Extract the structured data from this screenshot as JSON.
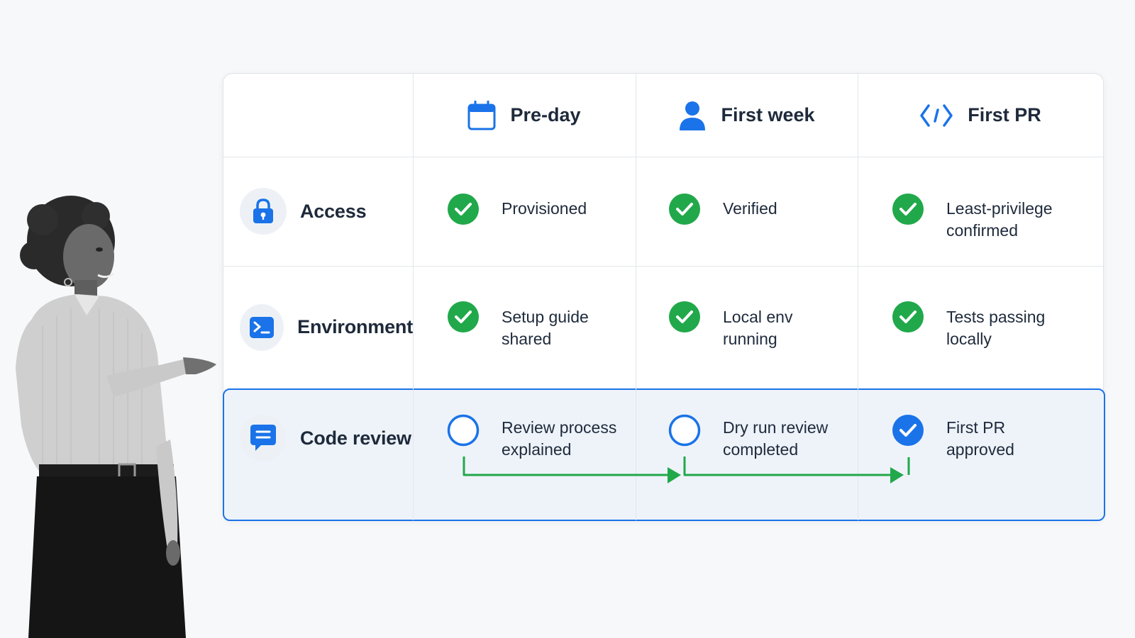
{
  "columns": [
    {
      "label": "Pre-day",
      "icon": "calendar-icon"
    },
    {
      "label": "First week",
      "icon": "user-icon"
    },
    {
      "label": "First PR",
      "icon": "code-icon"
    }
  ],
  "rows": [
    {
      "label": "Access",
      "icon": "lock-icon",
      "cells": [
        {
          "text": "Provisioned",
          "status": "done"
        },
        {
          "text": "Verified",
          "status": "done"
        },
        {
          "text": "Least-privilege confirmed",
          "status": "done"
        }
      ]
    },
    {
      "label": "Environment",
      "icon": "terminal-icon",
      "cells": [
        {
          "text": "Setup guide shared",
          "status": "done"
        },
        {
          "text": "Local env running",
          "status": "done"
        },
        {
          "text": "Tests passing locally",
          "status": "done"
        }
      ]
    },
    {
      "label": "Code review",
      "icon": "chat-icon",
      "highlighted": true,
      "cells": [
        {
          "text": "Review process explained",
          "status": "open"
        },
        {
          "text": "Dry run review completed",
          "status": "open"
        },
        {
          "text": "First PR approved",
          "status": "checked"
        }
      ]
    }
  ],
  "colors": {
    "done": "#21a84a",
    "accent": "#1a73e8",
    "text": "#1e2a3b"
  }
}
